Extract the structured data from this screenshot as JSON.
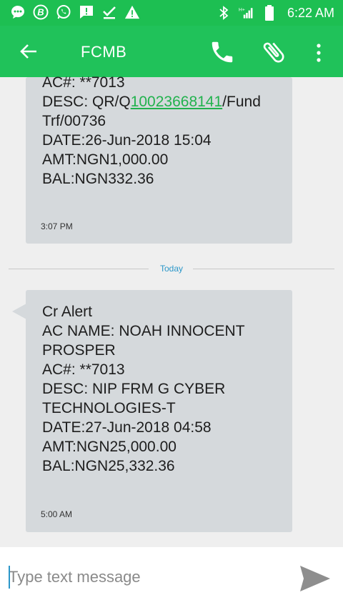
{
  "status_bar": {
    "time": "6:22 AM",
    "left_icons": [
      "chat-bubble-icon",
      "b-circle-icon",
      "whatsapp-icon",
      "message-alert-icon",
      "check-icon",
      "warning-icon"
    ],
    "right_icons": [
      "bluetooth-icon",
      "signal-icon",
      "battery-icon"
    ]
  },
  "app_bar": {
    "title": "FCMB",
    "back_icon": "arrow-left-icon",
    "call_icon": "phone-icon",
    "attach_icon": "paperclip-icon",
    "more_icon": "more-vertical-icon",
    "accent": "#20c25a"
  },
  "messages": [
    {
      "before_link": "AC#: **7013\nDESC: QR/Q",
      "link": "10023668141",
      "after_link": "/Fund\nTrf/00736\nDATE:26-Jun-2018 15:04\nAMT:NGN1,000.00\nBAL:NGN332.36",
      "time": "3:07 PM"
    },
    {
      "text": "Cr Alert\nAC NAME: NOAH INNOCENT\nPROSPER\nAC#: **7013\nDESC: NIP FRM G CYBER\nTECHNOLOGIES-T\nDATE:27-Jun-2018 04:58\nAMT:NGN25,000.00\nBAL:NGN25,332.36",
      "time": "5:00 AM"
    }
  ],
  "divider": {
    "label": "Today"
  },
  "compose": {
    "placeholder": "Type text message",
    "send_icon": "send-icon"
  }
}
